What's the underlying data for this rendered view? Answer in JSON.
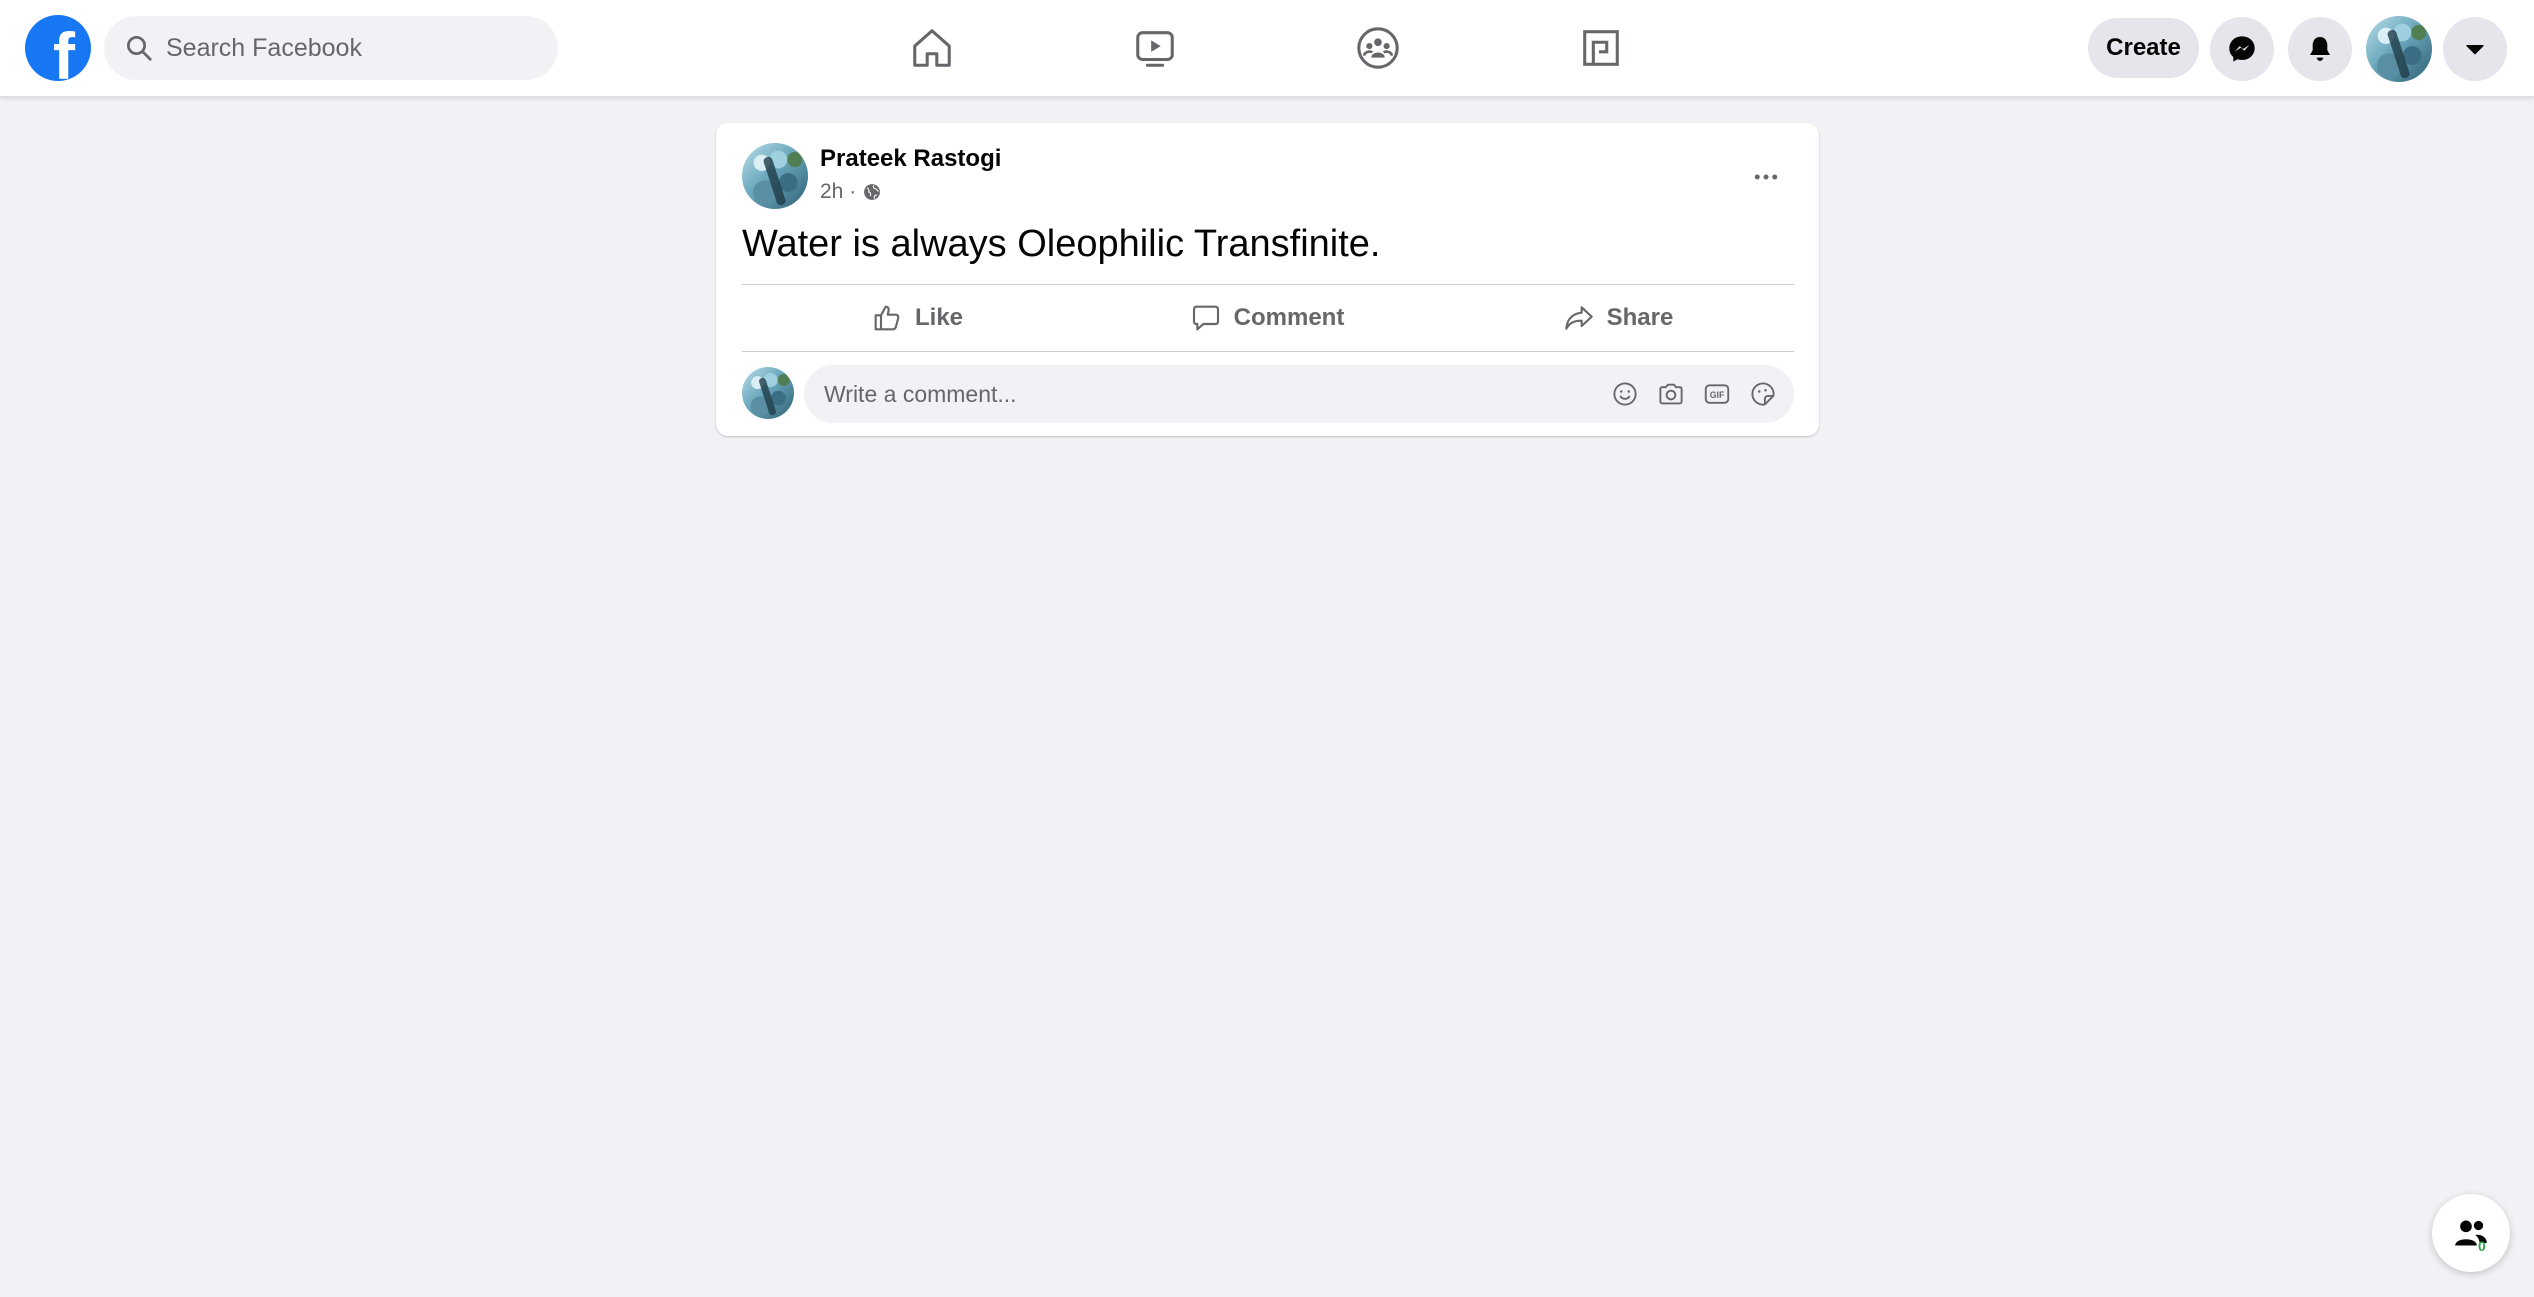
{
  "header": {
    "logo_letter": "f",
    "search": {
      "placeholder": "Search Facebook",
      "value": ""
    },
    "nav": [
      {
        "icon": "home-icon"
      },
      {
        "icon": "video-icon"
      },
      {
        "icon": "groups-icon"
      },
      {
        "icon": "gaming-icon"
      }
    ],
    "create_label": "Create",
    "messenger_icon": "messenger-icon",
    "notifications_icon": "bell-icon",
    "account_menu_icon": "caret-down-icon"
  },
  "post": {
    "author": "Prateek Rastogi",
    "time": "2h ·",
    "privacy_icon": "globe-icon",
    "text": "Water is always Oleophilic Transfinite.",
    "actions": {
      "like": "Like",
      "comment": "Comment",
      "share": "Share"
    },
    "comment_placeholder": "Write a comment...",
    "comment_icons": [
      "emoji-icon",
      "camera-icon",
      "gif-icon",
      "sticker-icon"
    ]
  },
  "contacts_badge": "0",
  "colors": {
    "brand": "#1877f2",
    "page_bg": "#f0f2f5",
    "text_secondary": "#65676b",
    "online_green": "#31a24c"
  }
}
